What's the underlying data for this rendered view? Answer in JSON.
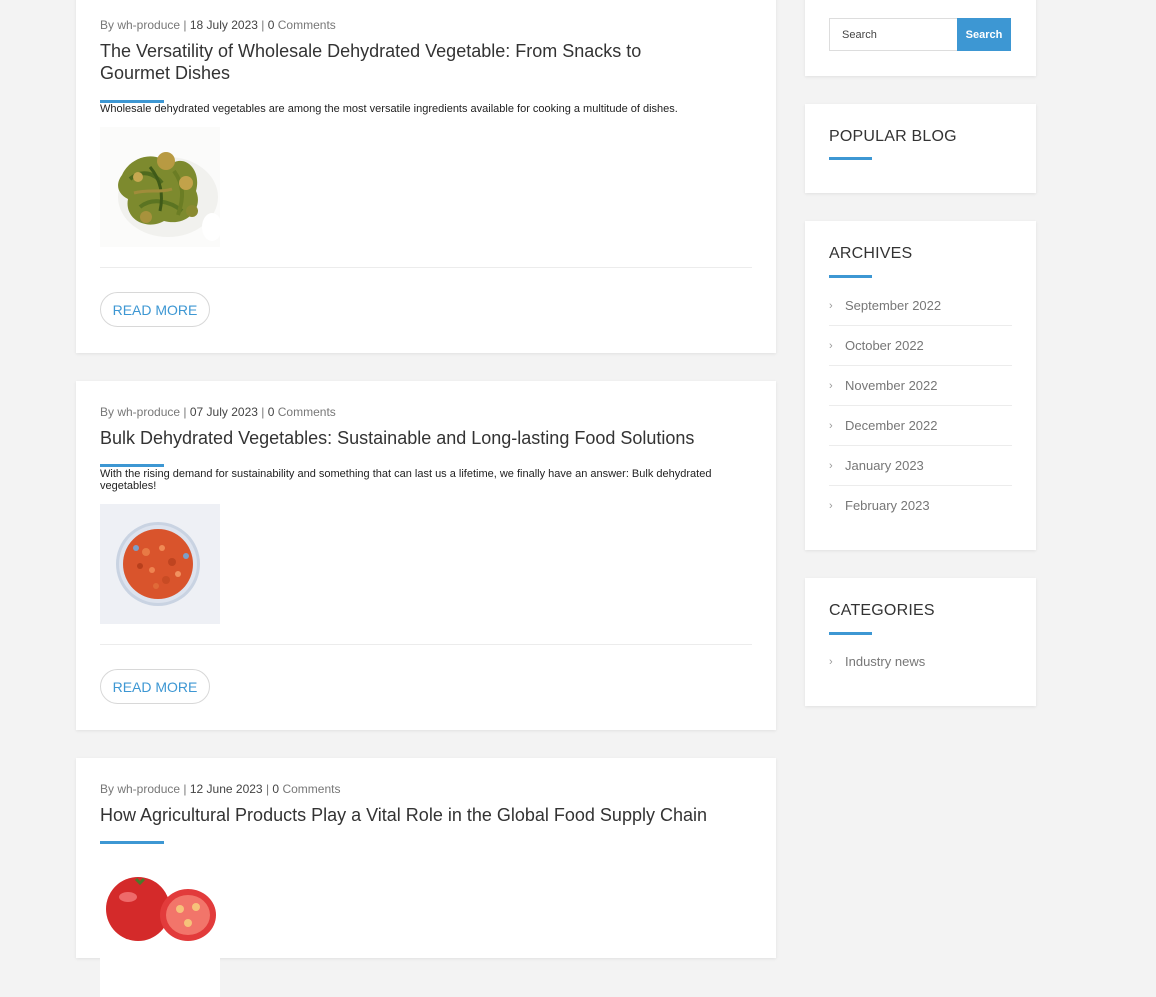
{
  "posts": [
    {
      "meta": {
        "by": "By wh-produce",
        "sep": "|",
        "date": "18 July 2023",
        "comments_count": "0",
        "comments_word": "Comments"
      },
      "title": "The Versatility of Wholesale Dehydrated Vegetable: From Snacks to Gourmet Dishes",
      "excerpt": "Wholesale dehydrated vegetables are among the most versatile ingredients available for cooking a multitude of dishes.",
      "read_more": "READ MORE"
    },
    {
      "meta": {
        "by": "By wh-produce",
        "sep": "|",
        "date": "07 July 2023",
        "comments_count": "0",
        "comments_word": "Comments"
      },
      "title": "Bulk Dehydrated Vegetables: Sustainable and Long-lasting Food Solutions",
      "excerpt": "With the rising demand for sustainability and something that can last us a lifetime, we finally have an answer: Bulk dehydrated vegetables!",
      "read_more": "READ MORE"
    },
    {
      "meta": {
        "by": "By wh-produce",
        "sep": "|",
        "date": "12 June 2023",
        "comments_count": "0",
        "comments_word": "Comments"
      },
      "title": "How Agricultural Products Play a Vital Role in the Global Food Supply Chain"
    }
  ],
  "sidebar": {
    "search": {
      "placeholder": "Search",
      "button": "Search"
    },
    "popular_title": "POPULAR BLOG",
    "archives_title": "ARCHIVES",
    "archives": [
      "September 2022",
      "October 2022",
      "November 2022",
      "December 2022",
      "January 2023",
      "February 2023"
    ],
    "categories_title": "CATEGORIES",
    "categories": [
      "Industry news"
    ]
  },
  "colors": {
    "accent": "#3d97d3",
    "page_bg": "#f3f3f3"
  }
}
